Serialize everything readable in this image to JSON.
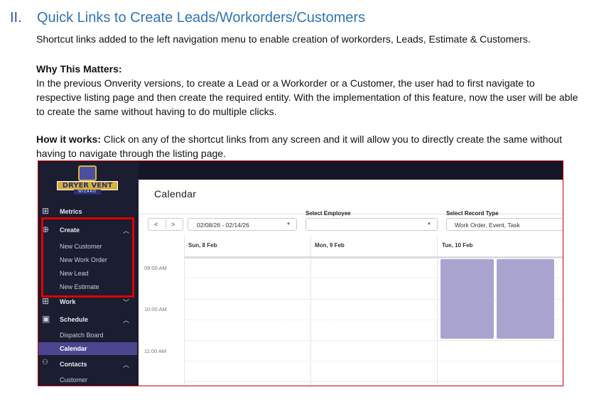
{
  "section": {
    "number": "II.",
    "title": "Quick Links to Create Leads/Workorders/Customers"
  },
  "intro": "Shortcut links added to the left navigation menu to enable creation of workorders, Leads, Estimate & Customers.",
  "why": {
    "heading": "Why This Matters:",
    "body": "In the previous Onverity versions, to create a Lead or a Workorder or a Customer, the user had to first navigate to respective listing page and then create the required entity. With the implementation of this feature, now the user will be able to create the same without having to do multiple clicks."
  },
  "how": {
    "label": "How it works:",
    "body": " Click on any of the shortcut links from any screen and it will allow you to directly create the same without having to navigate through the listing page."
  },
  "app": {
    "logo_text": "DRYER VENT",
    "logo_sub": "WIZARD",
    "sidebar": {
      "metrics": "Metrics",
      "create": "Create",
      "create_items": [
        "New Customer",
        "New Work Order",
        "New Lead",
        "New Estimate"
      ],
      "work": "Work",
      "schedule": "Schedule",
      "schedule_items": [
        "Dispatch Board",
        "Calendar"
      ],
      "contacts": "Contacts",
      "contacts_items": [
        "Customer"
      ]
    },
    "calendar": {
      "title": "Calendar",
      "prev": "<",
      "next": ">",
      "date_range": "02/08/26 - 02/14/26",
      "select_employee_label": "Select Employee",
      "select_employee_value": "",
      "select_record_label": "Select Record Type",
      "select_record_value": "Work Order, Event, Task",
      "days": [
        "Sun, 8 Feb",
        "Mon, 9 Feb",
        "Tue, 10 Feb"
      ],
      "times": [
        "09:00 AM",
        "10:00 AM",
        "11:00 AM"
      ]
    },
    "colors": {
      "sidebar_bg": "#1b1d30",
      "active_item": "#4c4690",
      "event": "#a9a4cf",
      "highlight": "#e00000"
    }
  }
}
